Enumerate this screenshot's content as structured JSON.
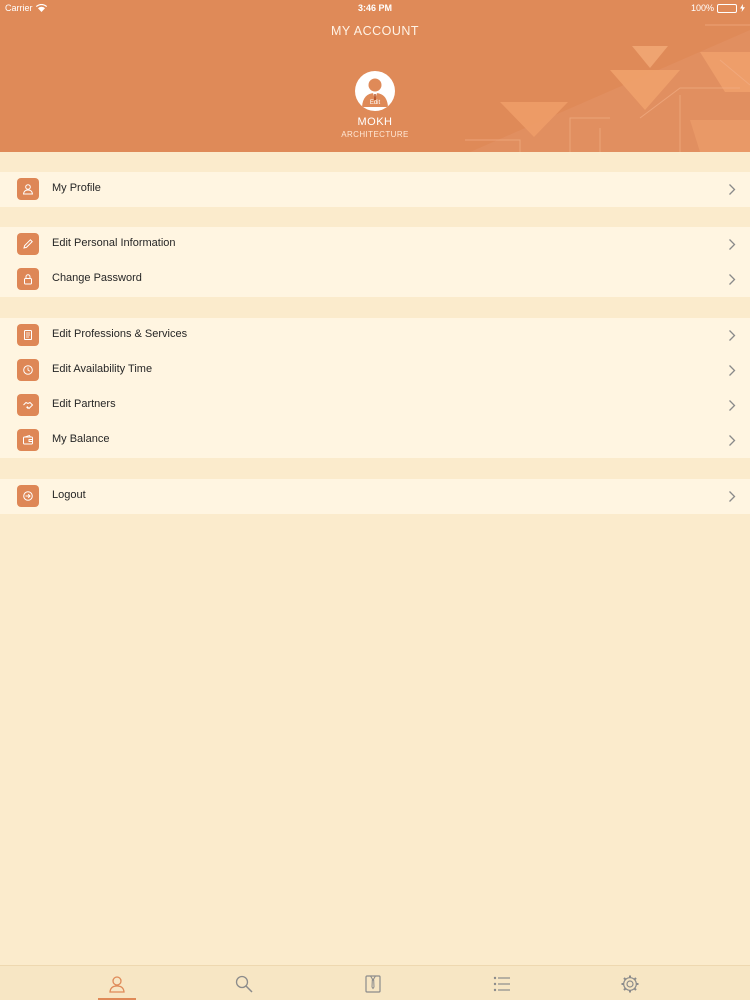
{
  "status_bar": {
    "carrier": "Carrier",
    "time": "3:46 PM",
    "battery": "100%"
  },
  "header": {
    "title": "MY ACCOUNT",
    "avatar_badge": "Edit",
    "user_name": "MOKH",
    "user_role": "ARCHITECTURE"
  },
  "menu": {
    "group1": [
      {
        "label": "My Profile",
        "icon": "user-icon"
      }
    ],
    "group2": [
      {
        "label": "Edit Personal Information",
        "icon": "pencil-icon"
      },
      {
        "label": "Change Password",
        "icon": "lock-icon"
      }
    ],
    "group3": [
      {
        "label": "Edit Professions & Services",
        "icon": "document-icon"
      },
      {
        "label": "Edit Availability Time",
        "icon": "clock-icon"
      },
      {
        "label": "Edit Partners",
        "icon": "handshake-icon"
      },
      {
        "label": "My Balance",
        "icon": "wallet-icon"
      }
    ],
    "group4": [
      {
        "label": "Logout",
        "icon": "logout-icon"
      }
    ]
  },
  "tabbar": {
    "active": "account",
    "tabs": [
      {
        "icon": "user-icon"
      },
      {
        "icon": "search-icon"
      },
      {
        "icon": "shirt-icon"
      },
      {
        "icon": "list-icon"
      },
      {
        "icon": "gear-icon"
      }
    ]
  },
  "colors": {
    "accent": "#df8a58",
    "background": "#fbebcc",
    "row": "#fff5e1"
  }
}
